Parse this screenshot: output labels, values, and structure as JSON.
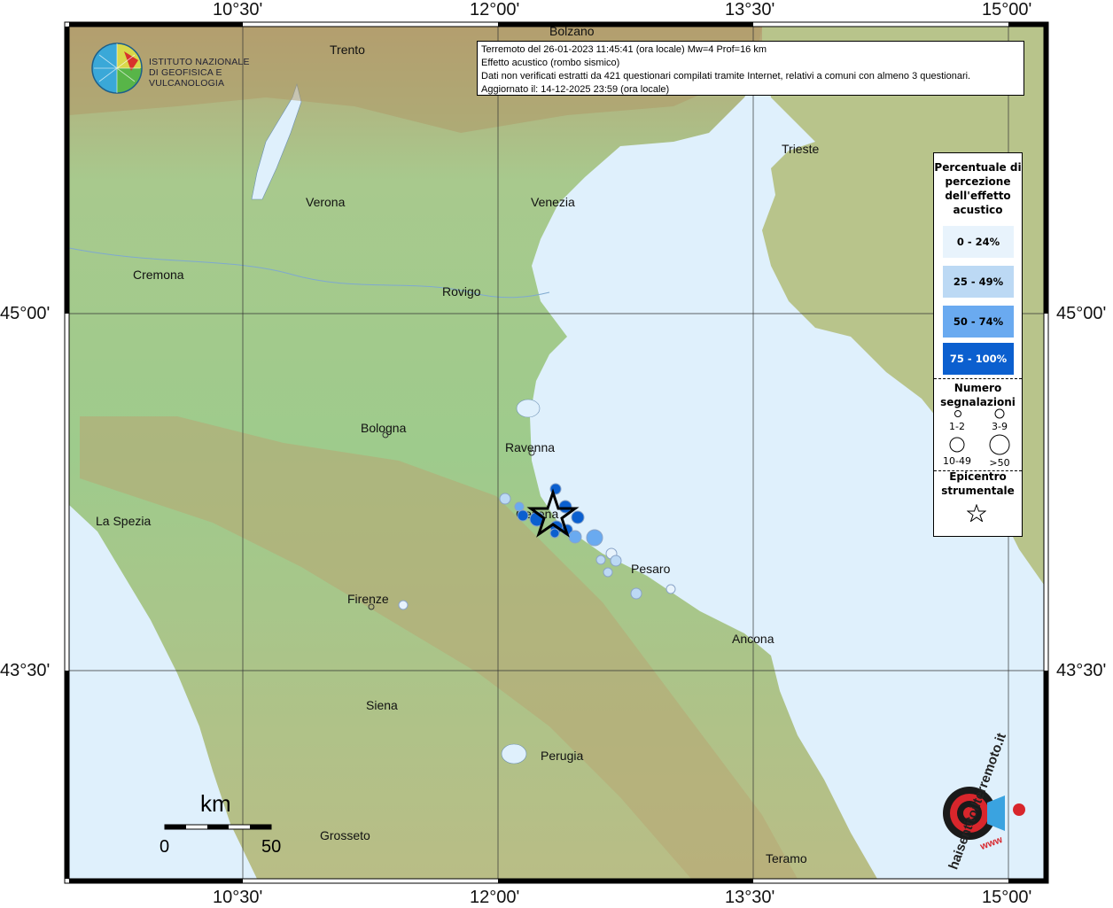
{
  "info": {
    "line1": "Terremoto del 26-01-2023 11:45:41 (ora locale) Mw=4 Prof=16 km",
    "line2": "Effetto acustico (rombo sismico)",
    "line3": "Dati non verificati estratti da 421 questionari compilati tramite Internet, relativi a comuni con almeno 3 questionari.",
    "line4": "Aggiornato il: 14-12-2025 23:59 (ora locale)"
  },
  "coords": {
    "lon": [
      "10°30'",
      "12°00'",
      "13°30'",
      "15°00'"
    ],
    "lat": [
      "45°00'",
      "43°30'"
    ]
  },
  "logo": {
    "line1": "ISTITUTO NAZIONALE",
    "line2": "DI GEOFISICA E VULCANOLOGIA"
  },
  "cities": [
    {
      "name": "Trento"
    },
    {
      "name": "Trieste"
    },
    {
      "name": "Verona"
    },
    {
      "name": "Venezia"
    },
    {
      "name": "Cremona"
    },
    {
      "name": "Rovigo"
    },
    {
      "name": "Bologna"
    },
    {
      "name": "Ravenna"
    },
    {
      "name": "La Spezia"
    },
    {
      "name": "Cesena"
    },
    {
      "name": "Pesaro"
    },
    {
      "name": "Firenze"
    },
    {
      "name": "Ancona"
    },
    {
      "name": "Siena"
    },
    {
      "name": "Perugia"
    },
    {
      "name": "Grosseto"
    },
    {
      "name": "Teramo"
    },
    {
      "name": "Bolzano"
    }
  ],
  "legend": {
    "title": "Percentuale di percezione dell'effetto acustico",
    "bins": [
      {
        "label": "0 - 24%",
        "color": "#e8f3fc"
      },
      {
        "label": "25 - 49%",
        "color": "#bcd9f4"
      },
      {
        "label": "50 - 74%",
        "color": "#6aaaf0"
      },
      {
        "label": "75 - 100%",
        "color": "#0b5fcf"
      }
    ],
    "count_title": "Numero segnalazioni",
    "counts": [
      "1-2",
      "3-9",
      "10-49",
      ">50"
    ],
    "epicenter_title": "Epicentro strumentale"
  },
  "scale": {
    "unit": "km",
    "start": "0",
    "end": "50"
  },
  "badge": {
    "text": "haisentitoilterremoto.it",
    "url": "www"
  },
  "colors": {
    "sea": "#dff0fc",
    "land": "#9dcc8e",
    "hills": "#c9c08a",
    "mountains": "#a88a5e"
  }
}
